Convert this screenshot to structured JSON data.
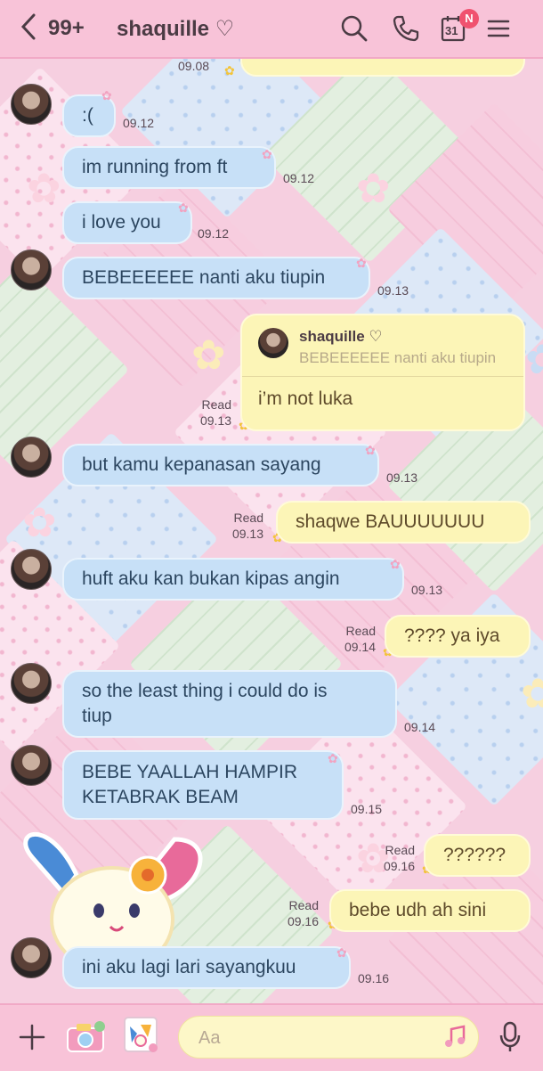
{
  "header": {
    "back_count": "99+",
    "chat_name": "shaquille ♡",
    "calendar_day": "31",
    "calendar_badge": "N"
  },
  "top_partial_time": "09.08",
  "messages": [
    {
      "side": "in",
      "text": ":(",
      "time": "09.12"
    },
    {
      "side": "in",
      "text": "im running from ft",
      "time": "09.12"
    },
    {
      "side": "in",
      "text": "i love you",
      "time": "09.12"
    },
    {
      "side": "in",
      "text": "BEBEEEEEE nanti aku tiupin",
      "time": "09.13"
    },
    {
      "side": "out",
      "read": "Read",
      "time": "09.13",
      "reply_to_name": "shaquille ♡",
      "reply_to_text": "BEBEEEEEE nanti aku tiupin",
      "text": "i’m not luka"
    },
    {
      "side": "in",
      "text": "but kamu kepanasan sayang",
      "time": "09.13"
    },
    {
      "side": "out",
      "read": "Read",
      "time": "09.13",
      "text": "shaqwe BAUUUUUUU"
    },
    {
      "side": "in",
      "text": "huft aku kan bukan kipas angin",
      "time": "09.13"
    },
    {
      "side": "out",
      "read": "Read",
      "time": "09.14",
      "text": "???? ya iya"
    },
    {
      "side": "in",
      "text_line1": "so the least thing i could do is",
      "text_line2": "tiup",
      "time": "09.14"
    },
    {
      "side": "in",
      "text_line1": "BEBE YAALLAH HAMPIR",
      "text_line2": "KETABRAK BEAM",
      "time": "09.15"
    },
    {
      "side": "out",
      "read": "Read",
      "time": "09.16",
      "text": "??????"
    },
    {
      "side": "out",
      "read": "Read",
      "time": "09.16",
      "text": "bebe udh ah sini"
    },
    {
      "side": "in",
      "text": "ini aku lagi lari sayangkuu",
      "time": "09.16"
    }
  ],
  "input": {
    "placeholder": "Aa"
  },
  "icons": [
    "back-chevron-icon",
    "search-icon",
    "phone-icon",
    "calendar-icon",
    "menu-icon",
    "plus-icon",
    "camera-icon",
    "sticker-icon",
    "music-note-icon",
    "microphone-icon"
  ],
  "colors": {
    "header": "#f8c3d8",
    "bubble_in": "#c7e0f7",
    "bubble_out": "#fcf5b7",
    "badge": "#f0526f"
  }
}
